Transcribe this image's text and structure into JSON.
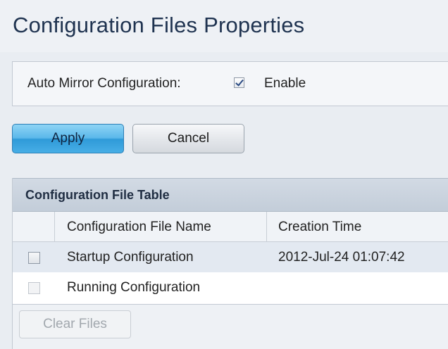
{
  "page": {
    "title": "Configuration Files Properties"
  },
  "mirror": {
    "label": "Auto Mirror Configuration:",
    "enabled": true,
    "enable_label": "Enable"
  },
  "actions": {
    "apply_label": "Apply",
    "cancel_label": "Cancel"
  },
  "table": {
    "caption": "Configuration File Table",
    "columns": [
      "Configuration File Name",
      "Creation Time"
    ],
    "rows": [
      {
        "name": "Startup Configuration",
        "creation_time": "2012-Jul-24 01:07:42",
        "checked": false
      },
      {
        "name": "Running Configuration",
        "creation_time": "",
        "checked": false
      }
    ],
    "clear_label": "Clear Files"
  },
  "colors": {
    "apply_button": "#47aee6",
    "caption_bar": "#c3cdd9",
    "selected_row": "#e3e9f1"
  }
}
